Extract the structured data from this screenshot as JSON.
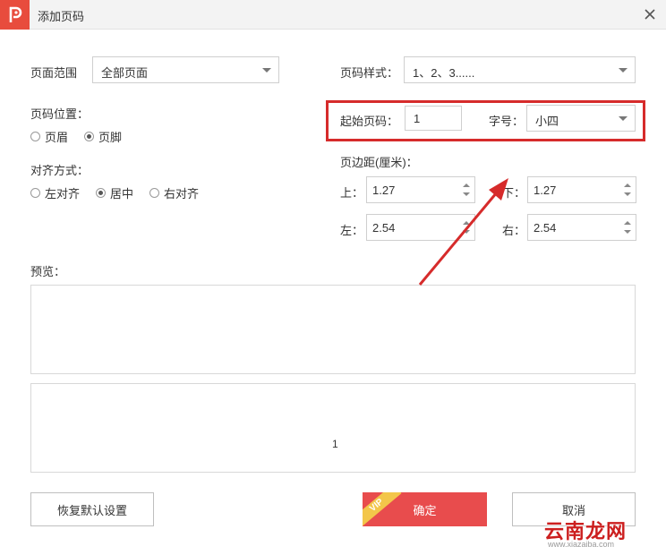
{
  "window": {
    "title": "添加页码"
  },
  "page_range": {
    "label": "页面范围",
    "value": "全部页面"
  },
  "number_style": {
    "label": "页码样式：",
    "value": "1、2、3......"
  },
  "position": {
    "label": "页码位置：",
    "options": [
      {
        "label": "页眉",
        "checked": false
      },
      {
        "label": "页脚",
        "checked": true
      }
    ]
  },
  "alignment": {
    "label": "对齐方式：",
    "options": [
      {
        "label": "左对齐",
        "checked": false
      },
      {
        "label": "居中",
        "checked": true
      },
      {
        "label": "右对齐",
        "checked": false
      }
    ]
  },
  "start_number": {
    "label": "起始页码：",
    "value": "1"
  },
  "font_size": {
    "label": "字号：",
    "value": "小四"
  },
  "margins": {
    "label": "页边距(厘米)：",
    "top": {
      "label": "上：",
      "value": "1.27"
    },
    "bottom": {
      "label": "下：",
      "value": "1.27"
    },
    "left": {
      "label": "左：",
      "value": "2.54"
    },
    "right": {
      "label": "右：",
      "value": "2.54"
    }
  },
  "preview": {
    "label": "预览：",
    "page_number": "1"
  },
  "buttons": {
    "reset": "恢复默认设置",
    "ok": "确定",
    "cancel": "取消",
    "vip_badge": "VIP"
  },
  "watermark": {
    "brand": "云南龙网",
    "url": "www.xiazaiba.com"
  },
  "colors": {
    "accent": "#e84c4d",
    "highlight": "#d62b2b",
    "arrow": "#d62b2b",
    "vip": "#f3c64a"
  }
}
